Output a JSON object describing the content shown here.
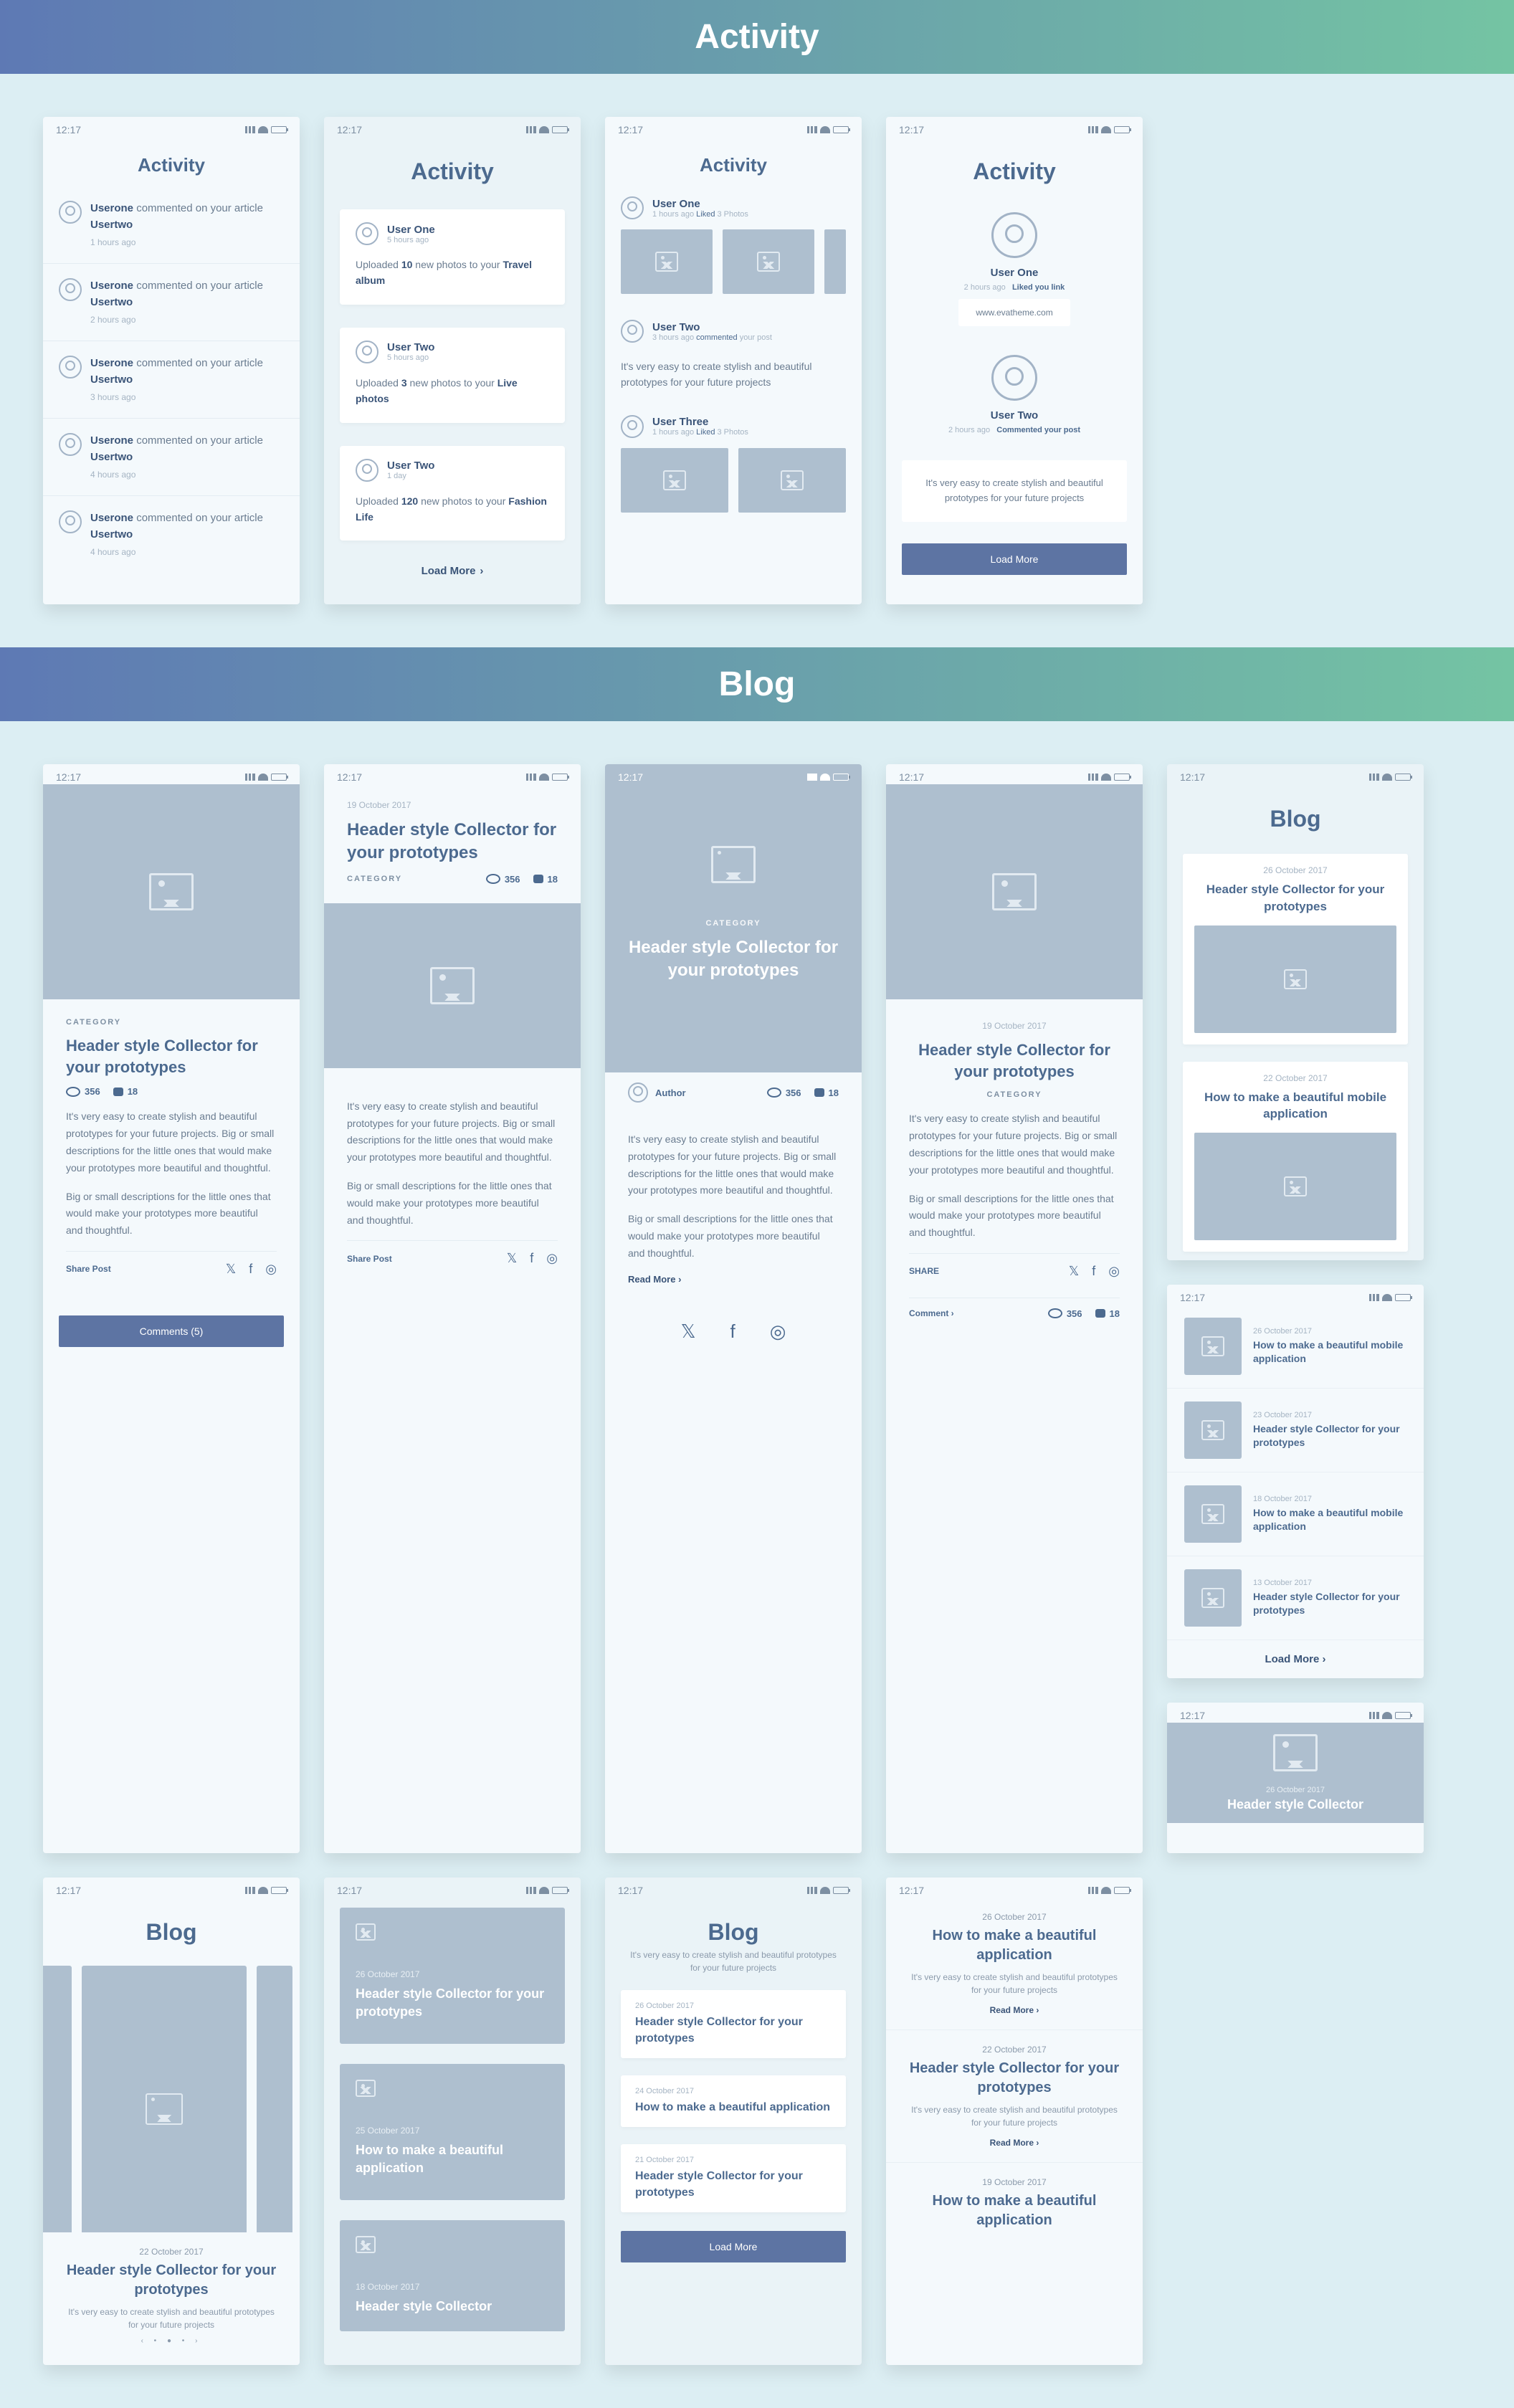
{
  "sections": {
    "activity": "Activity",
    "blog": "Blog"
  },
  "time": "12:17",
  "activity1": {
    "title": "Activity",
    "items": [
      {
        "user": "Userone",
        "text": " commented on your article ",
        "target": "Usertwo",
        "time": "1 hours ago"
      },
      {
        "user": "Userone",
        "text": " commented on your article ",
        "target": "Usertwo",
        "time": "2 hours ago"
      },
      {
        "user": "Userone",
        "text": " commented on your article ",
        "target": "Usertwo",
        "time": "3 hours ago"
      },
      {
        "user": "Userone",
        "text": " commented on your article ",
        "target": "Usertwo",
        "time": "4 hours ago"
      },
      {
        "user": "Userone",
        "text": " commented on your article ",
        "target": "Usertwo",
        "time": "4 hours ago"
      }
    ]
  },
  "activity2": {
    "title": "Activity",
    "cards": [
      {
        "name": "User One",
        "sub": "5 hours ago",
        "body_a": "Uploaded ",
        "body_b": "10",
        "body_c": " new photos to your ",
        "body_d": "Travel album"
      },
      {
        "name": "User Two",
        "sub": "5 hours ago",
        "body_a": "Uploaded ",
        "body_b": "3",
        "body_c": " new photos to your ",
        "body_d": "Live photos"
      },
      {
        "name": "User Two",
        "sub": "1 day",
        "body_a": "Uploaded ",
        "body_b": "120",
        "body_c": " new photos to your ",
        "body_d": "Fashion Life"
      }
    ],
    "load": "Load More"
  },
  "activity3": {
    "title": "Activity",
    "items": [
      {
        "name": "User One",
        "sub": "1 hours ago ",
        "act": "Liked",
        "tail": " 3 Photos",
        "thumbs": 3
      },
      {
        "name": "User Two",
        "sub": "3 hours ago ",
        "act": "commented",
        "tail": " your post",
        "text": "It's very easy to create stylish and beautiful prototypes for your future projects"
      },
      {
        "name": "User Three",
        "sub": "1 hours ago ",
        "act": "Liked",
        "tail": " 3 Photos",
        "thumbs": 2
      }
    ]
  },
  "activity4": {
    "title": "Activity",
    "u1": {
      "name": "User One",
      "sub": "2 hours ago",
      "act": "Liked you link",
      "link": "www.evatheme.com"
    },
    "u2": {
      "name": "User Two",
      "sub": "2 hours ago",
      "act": "Commented your post",
      "quote": "It's very easy to create stylish and beautiful prototypes for your future projects"
    },
    "btn": "Load More"
  },
  "blog1": {
    "cat": "CATEGORY",
    "title": "Header style Collector for your prototypes",
    "views": "356",
    "comments": "18",
    "p1": "It's very easy to create stylish and beautiful prototypes for your future projects. Big or small descriptions for the little ones that would make your prototypes more beautiful and thoughtful.",
    "p2": "Big or small descriptions for the little ones that would make your prototypes more beautiful and thoughtful.",
    "share": "Share Post",
    "btn": "Comments (5)"
  },
  "blog2": {
    "date": "19 October 2017",
    "title": "Header style Collector for your prototypes",
    "cat": "CATEGORY",
    "views": "356",
    "comments": "18",
    "p1": "It's very easy to create stylish and beautiful prototypes for your future projects. Big or small descriptions for the little ones that would make your prototypes more beautiful and thoughtful.",
    "p2": "Big or small descriptions for the little ones that would make your prototypes more beautiful and thoughtful.",
    "share": "Share Post"
  },
  "blog3": {
    "cat": "CATEGORY",
    "title": "Header style Collector for your prototypes",
    "author": "Author",
    "views": "356",
    "comments": "18",
    "p1": "It's very easy to create stylish and beautiful prototypes for your future projects. Big or small descriptions for the little ones that would make your prototypes more beautiful and thoughtful.",
    "p2": "Big or small descriptions for the little ones that would make your prototypes more beautiful and thoughtful.",
    "read": "Read More"
  },
  "blog4": {
    "date": "19 October 2017",
    "title": "Header style Collector for your prototypes",
    "cat": "CATEGORY",
    "p1": "It's very easy to create stylish and beautiful prototypes for your future projects. Big or small descriptions for the little ones that would make your prototypes more beautiful and thoughtful.",
    "p2": "Big or small descriptions for the little ones that would make your prototypes more beautiful and thoughtful.",
    "share": "SHARE",
    "comment": "Comment",
    "views": "356",
    "cm": "18"
  },
  "blog5": {
    "title": "Blog",
    "c1": {
      "date": "26 October 2017",
      "title": "Header style Collector for your prototypes"
    },
    "c2": {
      "date": "22 October 2017",
      "title": "How to make a beautiful mobile application"
    }
  },
  "blog6": {
    "title": "Blog",
    "date": "22 October 2017",
    "h": "Header style Collector for your prototypes",
    "sub": "It's very easy to create stylish and beautiful prototypes for your future projects"
  },
  "blog7": {
    "c1": {
      "date": "26 October 2017",
      "title": "Header style Collector for your prototypes"
    },
    "c2": {
      "date": "25 October 2017",
      "title": "How to make a beautiful application"
    },
    "c3": {
      "date": "18 October 2017",
      "title": "Header style Collector"
    }
  },
  "blog8": {
    "title": "Blog",
    "sub": "It's very easy to create stylish and beautiful prototypes for your future projects",
    "c1": {
      "date": "26 October 2017",
      "title": "Header style Collector for your prototypes"
    },
    "c2": {
      "date": "24 October 2017",
      "title": "How to make a beautiful application"
    },
    "c3": {
      "date": "21 October 2017",
      "title": "Header style Collector for your prototypes"
    },
    "btn": "Load More"
  },
  "blog9": {
    "items": [
      {
        "date": "26 October 2017",
        "title": "How to make a beautiful application",
        "sub": "It's very easy to create stylish and beautiful prototypes for your future projects",
        "read": "Read More"
      },
      {
        "date": "22 October 2017",
        "title": "Header style Collector for your prototypes",
        "sub": "It's very easy to create stylish and beautiful prototypes for your future projects",
        "read": "Read More"
      },
      {
        "date": "19 October 2017",
        "title": "How to make a beautiful application"
      }
    ]
  },
  "blog10": {
    "items": [
      {
        "date": "26 October 2017",
        "title": "How to make a beautiful mobile application"
      },
      {
        "date": "23 October 2017",
        "title": "Header style Collector for your prototypes"
      },
      {
        "date": "18 October 2017",
        "title": "How to make a beautiful mobile application"
      },
      {
        "date": "13 October 2017",
        "title": "Header style Collector for your prototypes"
      }
    ],
    "load": "Load More"
  },
  "blog11": {
    "date": "26 October 2017",
    "title": "Header style Collector"
  }
}
